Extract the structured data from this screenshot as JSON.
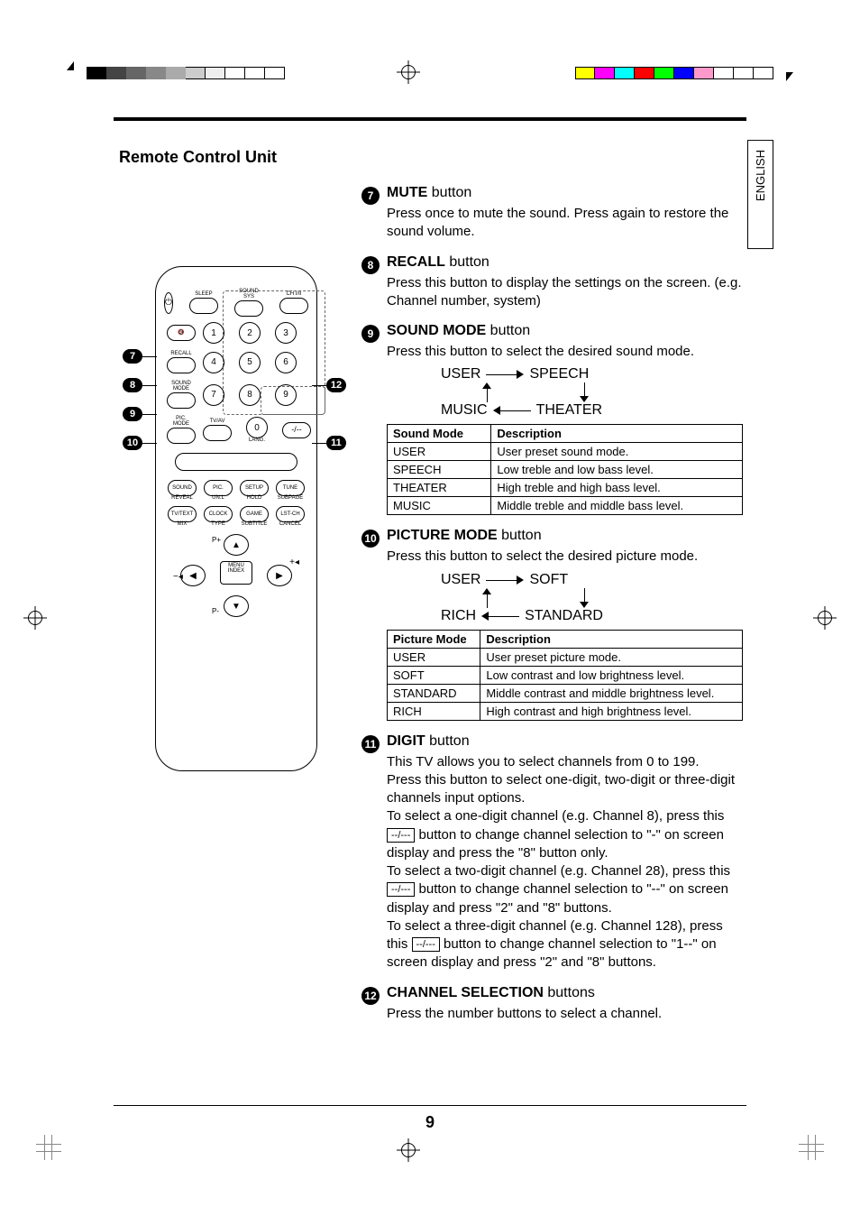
{
  "meta": {
    "language_tab": "ENGLISH",
    "page_number": "9"
  },
  "title": "Remote Control Unit",
  "remote_labels": {
    "sleep": "SLEEP",
    "sound_sys": "SOUND\nSYS",
    "ch": "CH I/II",
    "recall": "RECALL",
    "sound_mode": "SOUND\nMODE",
    "pic_mode": "PIC.\nMODE",
    "tv_av": "TV/AV",
    "lang": "LANG.",
    "row_func1": [
      "SOUND",
      "PIC.",
      "SETUP",
      "TUNE"
    ],
    "row_func1b": [
      "REVEAL",
      "UN.L",
      "HOLD",
      "SUBPAGE"
    ],
    "row_func2": [
      "TV/TEXT",
      "CLOCK",
      "GAME",
      "LST-CH"
    ],
    "row_func2b": [
      "MIX",
      "TYPE",
      "SUBTITLE",
      "CANCEL"
    ],
    "menu": "MENU",
    "index": "INDEX",
    "p_plus": "P+",
    "p_minus": "P-"
  },
  "callouts": {
    "c7": "7",
    "c8": "8",
    "c9": "9",
    "c10": "10",
    "c11": "11",
    "c12": "12"
  },
  "items": [
    {
      "num": "7",
      "name": "MUTE",
      "suffix": " button",
      "body": "Press once to mute the sound.  Press again to restore the sound volume."
    },
    {
      "num": "8",
      "name": "RECALL",
      "suffix": " button",
      "body": "Press this button to display the settings on the screen. (e.g. Channel number, system)"
    },
    {
      "num": "9",
      "name": "SOUND MODE",
      "suffix": " button",
      "body": "Press this button to select the desired sound mode.",
      "cycle": [
        "USER",
        "SPEECH",
        "THEATER",
        "MUSIC"
      ],
      "table_header": [
        "Sound Mode",
        "Description"
      ],
      "table": [
        [
          "USER",
          "User preset sound mode."
        ],
        [
          "SPEECH",
          "Low treble and low bass level."
        ],
        [
          "THEATER",
          "High treble and high bass level."
        ],
        [
          "MUSIC",
          "Middle treble and middle bass level."
        ]
      ]
    },
    {
      "num": "10",
      "name": "PICTURE MODE",
      "suffix": " button",
      "body": "Press this button to select the desired picture mode.",
      "cycle": [
        "USER",
        "SOFT",
        "STANDARD",
        "RICH"
      ],
      "table_header": [
        "Picture Mode",
        "Description"
      ],
      "table": [
        [
          "USER",
          "User preset picture mode."
        ],
        [
          "SOFT",
          "Low contrast and low brightness level."
        ],
        [
          "STANDARD",
          "Middle contrast and middle brightness level."
        ],
        [
          "RICH",
          "High contrast and high brightness level."
        ]
      ]
    },
    {
      "num": "11",
      "name": "DIGIT",
      "suffix": " button",
      "body_lines": [
        "This TV allows you to select channels from 0 to 199.",
        "Press this button to select one-digit, two-digit or three-digit channels input options.",
        "To select a one-digit channel (e.g. Channel 8), press this ",
        " button to change channel selection to \"-\" on screen display and press the \"8\" button only.",
        "To select a two-digit channel (e.g. Channel 28), press this ",
        " button to change channel selection to \"--\" on screen display and press \"2\" and \"8\" buttons.",
        "To select a three-digit channel (e.g. Channel 128), press this ",
        " button to change channel selection to \"1--\" on screen display and press \"2\" and \"8\" buttons."
      ],
      "inline_box": "--/---"
    },
    {
      "num": "12",
      "name": "CHANNEL SELECTION",
      "suffix": " buttons",
      "body": "Press the number buttons to select a channel."
    }
  ]
}
